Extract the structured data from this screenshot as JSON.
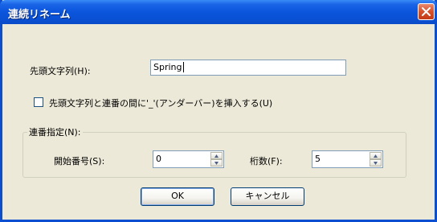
{
  "window": {
    "title": "連続リネーム"
  },
  "icons": {
    "close": "close-icon",
    "spin_up": "up-arrow-icon",
    "spin_down": "down-arrow-icon"
  },
  "prefix": {
    "label": "先頭文字列(H):",
    "value": "Spring"
  },
  "underscore_option": {
    "label": "先頭文字列と連番の間に'_'(アンダーバー)を挿入する(U)",
    "checked": false
  },
  "sequence": {
    "group_label": "連番指定(N):",
    "start_label": "開始番号(S):",
    "start_value": "0",
    "digits_label": "桁数(F):",
    "digits_value": "5"
  },
  "buttons": {
    "ok": "OK",
    "cancel": "キャンセル"
  },
  "colors": {
    "title_bar": "#0a55dc",
    "close_button": "#d6502a",
    "dialog_bg": "#ece9d8"
  }
}
